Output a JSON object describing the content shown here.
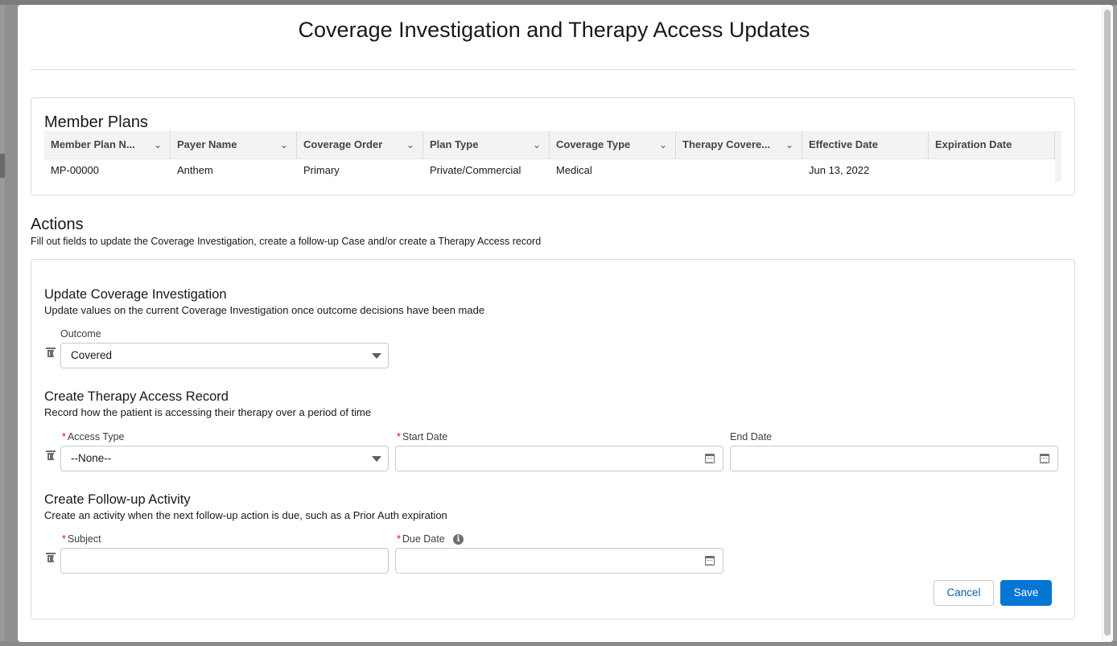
{
  "modal": {
    "title": "Coverage Investigation and Therapy Access Updates"
  },
  "member_plans": {
    "heading": "Member Plans",
    "columns": [
      "Member Plan N...",
      "Payer Name",
      "Coverage Order",
      "Plan Type",
      "Coverage Type",
      "Therapy Covere...",
      "Effective Date",
      "Expiration Date"
    ],
    "rows": [
      [
        "MP-00000",
        "Anthem",
        "Primary",
        "Private/Commercial",
        "Medical",
        "",
        "Jun 13, 2022",
        ""
      ]
    ]
  },
  "actions": {
    "heading": "Actions",
    "description": "Fill out fields to update the Coverage Investigation, create a follow-up Case and/or create a Therapy Access record"
  },
  "update_ci": {
    "heading": "Update Coverage Investigation",
    "description": "Update values on the current Coverage Investigation once outcome decisions have been made",
    "outcome_label": "Outcome",
    "outcome_value": "Covered"
  },
  "therapy_access": {
    "heading": "Create Therapy Access Record",
    "description": "Record how the patient is accessing their therapy over a period of time",
    "access_type_label": "Access Type",
    "access_type_value": "--None--",
    "start_date_label": "Start Date",
    "start_date_value": "",
    "end_date_label": "End Date",
    "end_date_value": ""
  },
  "follow_up": {
    "heading": "Create Follow-up Activity",
    "description": "Create an activity when the next follow-up action is due, such as a Prior Auth expiration",
    "subject_label": "Subject",
    "subject_value": "",
    "due_date_label": "Due Date",
    "due_date_value": ""
  },
  "buttons": {
    "cancel": "Cancel",
    "save": "Save"
  },
  "icons": {
    "delete": "trash-icon",
    "date": "calendar-icon",
    "select": "caret-down-icon",
    "sort": "chevron-down-icon",
    "help": "info-icon"
  },
  "colors": {
    "brand": "#0176d3",
    "required": "#ea001e"
  }
}
